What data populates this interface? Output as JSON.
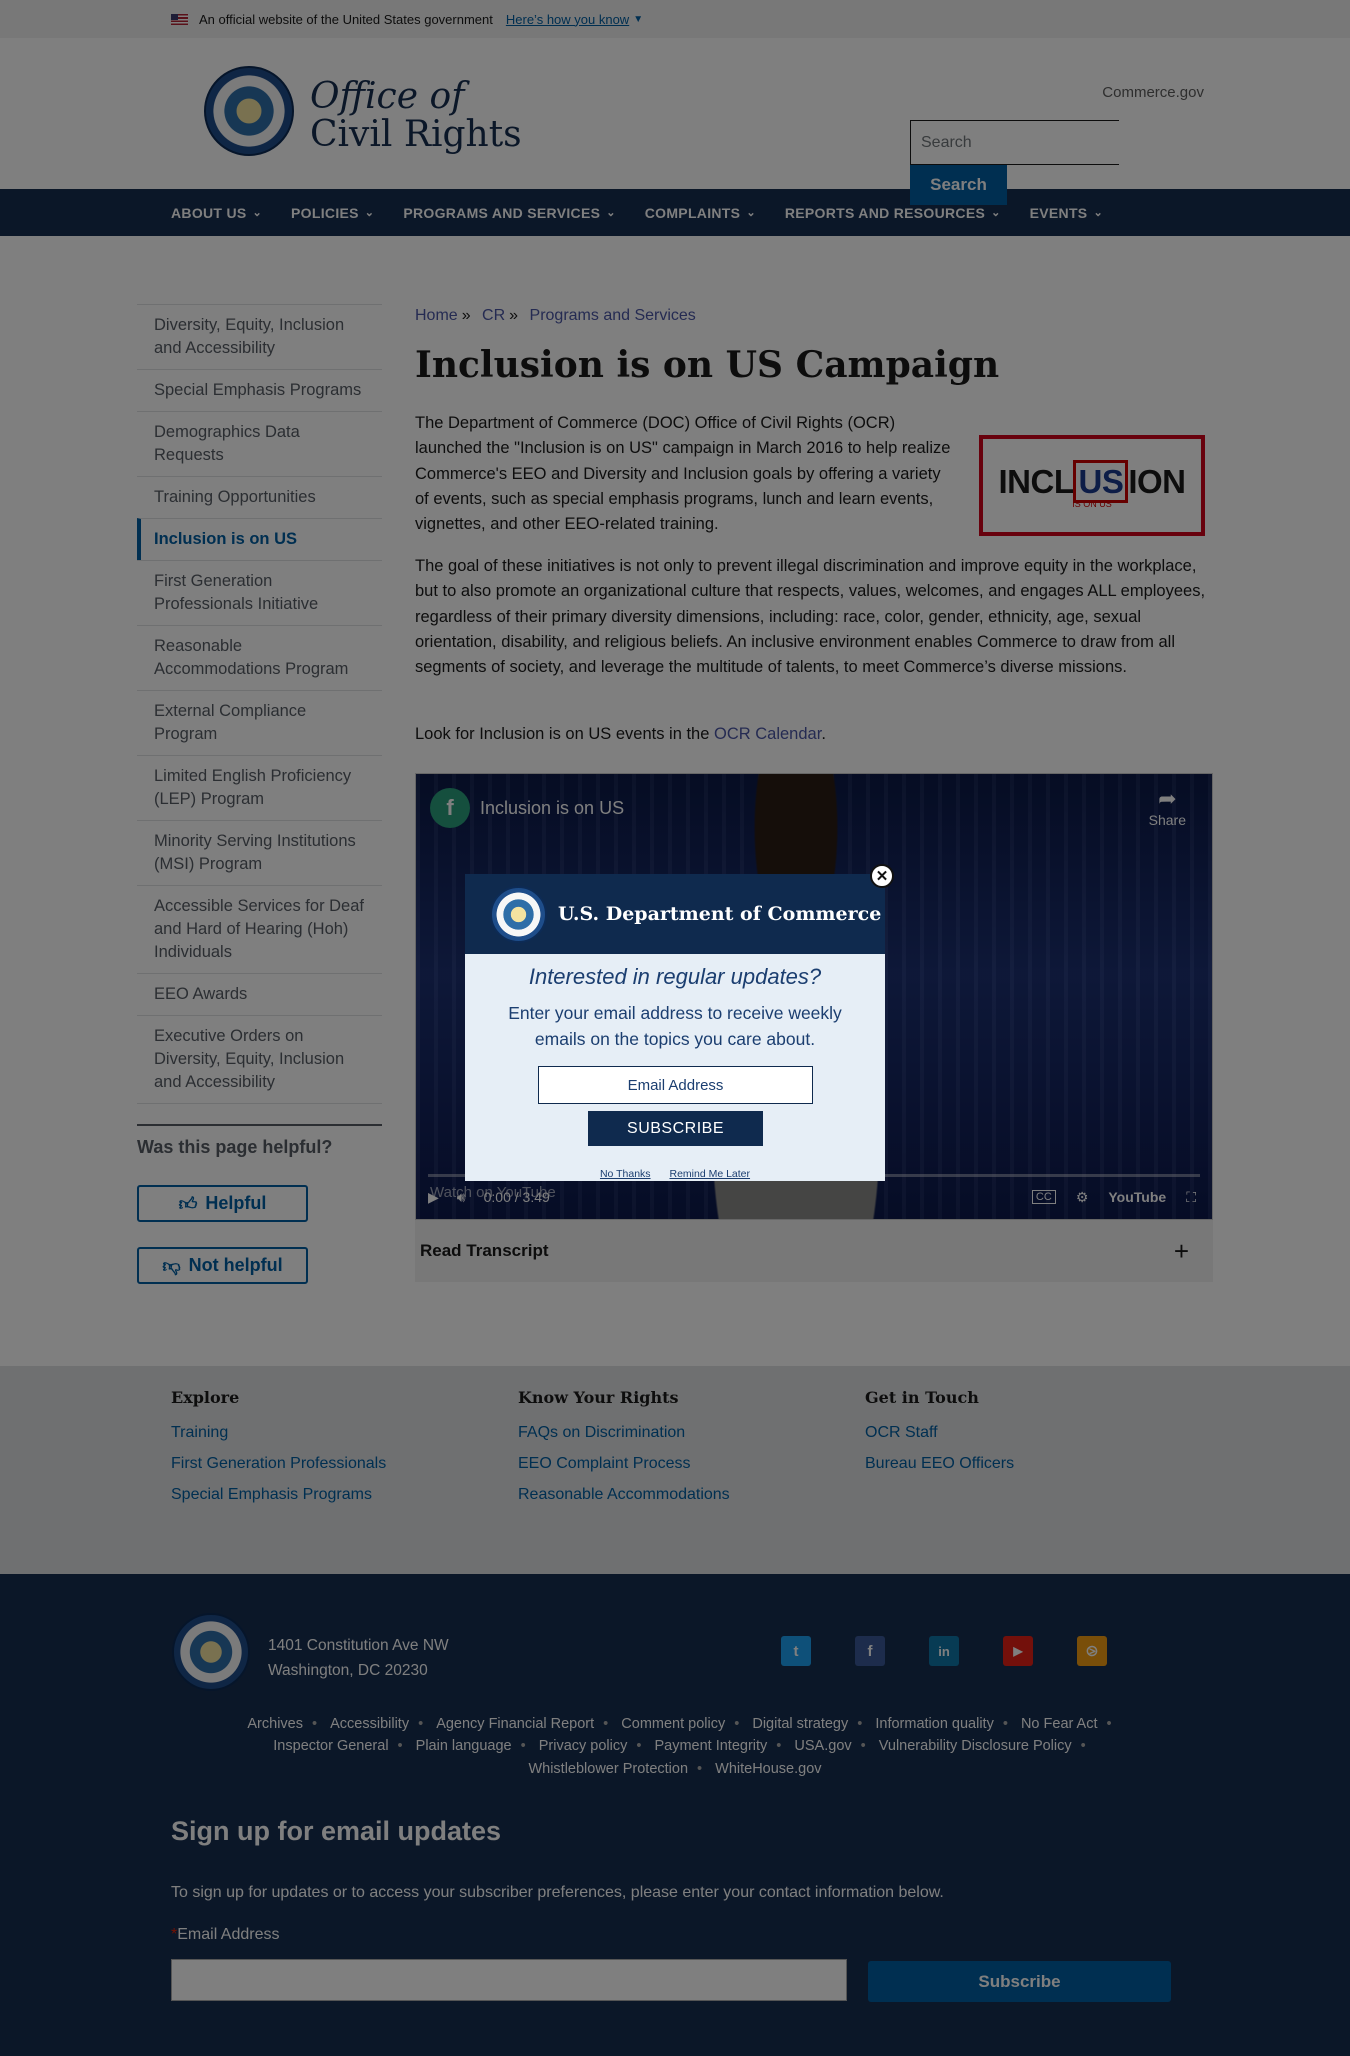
{
  "gov_banner": {
    "text": "An official website of the United States government",
    "link": "Here’s how you know"
  },
  "header": {
    "title_line1": "Office of",
    "title_line2": "Civil Rights",
    "commerce_link": "Commerce.gov",
    "search_placeholder": "Search",
    "search_button": "Search"
  },
  "nav": [
    {
      "label": "ABOUT US"
    },
    {
      "label": "POLICIES"
    },
    {
      "label": "PROGRAMS AND SERVICES"
    },
    {
      "label": "COMPLAINTS"
    },
    {
      "label": "REPORTS AND RESOURCES"
    },
    {
      "label": "EVENTS"
    }
  ],
  "sidenav": [
    {
      "label": "Diversity, Equity, Inclusion and Accessibility"
    },
    {
      "label": "Special Emphasis Programs"
    },
    {
      "label": "Demographics Data Requests"
    },
    {
      "label": "Training Opportunities"
    },
    {
      "label": "Inclusion is on US",
      "active": true
    },
    {
      "label": "First Generation Professionals Initiative"
    },
    {
      "label": "Reasonable Accommodations Program"
    },
    {
      "label": "External Compliance Program"
    },
    {
      "label": "Limited English Proficiency (LEP) Program"
    },
    {
      "label": "Minority Serving Institutions (MSI) Program"
    },
    {
      "label": "Accessible Services for Deaf and Hard of Hearing (Hoh) Individuals"
    },
    {
      "label": "EEO Awards"
    },
    {
      "label": "Executive Orders on Diversity, Equity, Inclusion and Accessibility"
    }
  ],
  "helpful": {
    "title": "Was this page helpful?",
    "yes": "Helpful",
    "no": "Not helpful"
  },
  "breadcrumb": {
    "home": "Home",
    "cr": "CR",
    "programs": "Programs and Services",
    "separator": "»"
  },
  "main": {
    "title": "Inclusion is on US Campaign",
    "p1": "The Department of Commerce (DOC) Office of Civil Rights (OCR) launched the \"Inclusion is on US\" campaign in March 2016 to help realize Commerce's EEO and Diversity and Inclusion goals by offering a variety of events, such as special emphasis programs, lunch and learn events, vignettes, and other EEO-related training.",
    "p2": "The goal of these initiatives is not only to prevent illegal discrimination and improve equity in the workplace, but to also promote an organizational culture that respects, values, welcomes, and engages ALL employees, regardless of their primary diversity dimensions, including: race, color, gender, ethnicity, age, sexual orientation, disability, and religious beliefs. An inclusive environment enables Commerce to draw from all segments of society, and leverage the multitude of talents, to meet Commerce’s diverse missions.",
    "p3_prefix": "Look for Inclusion is on US events in the ",
    "p3_link": "OCR Calendar",
    "p3_suffix": ".",
    "logo_text_a": "INCL",
    "logo_text_b": "US",
    "logo_text_c": "ION",
    "logo_sub": "IS ON US"
  },
  "video": {
    "channel_letter": "f",
    "title": "Inclusion is on US",
    "share": "Share",
    "watch_on": "Watch on",
    "youtube": "YouTube",
    "time": "0:00 / 3:49",
    "cc": "CC"
  },
  "transcript": {
    "label": "Read Transcript"
  },
  "modal": {
    "title": "U.S. Department of Commerce",
    "question": "Interested in regular updates?",
    "description": "Enter your email address to receive weekly emails on the topics you care about.",
    "email_placeholder": "Email Address",
    "subscribe": "SUBSCRIBE",
    "no_thanks": "No Thanks",
    "remind_later": "Remind Me Later"
  },
  "footer_links": {
    "explore": {
      "title": "Explore",
      "links": [
        "Training",
        "First Generation Professionals",
        "Special Emphasis Programs"
      ]
    },
    "rights": {
      "title": "Know Your Rights",
      "links": [
        "FAQs on Discrimination",
        "EEO Complaint Process",
        "Reasonable Accommodations"
      ]
    },
    "contact": {
      "title": "Get in Touch",
      "links": [
        "OCR Staff",
        "Bureau EEO Officers"
      ]
    }
  },
  "footer": {
    "address_line1": "1401 Constitution Ave NW",
    "address_line2": "Washington, DC 20230",
    "social": [
      "twitter-icon",
      "facebook-icon",
      "linkedin-icon",
      "youtube-icon",
      "rss-icon"
    ],
    "legal_row1": [
      "Archives",
      "Accessibility",
      "Agency Financial Report",
      "Comment policy",
      "Digital strategy",
      "Information quality",
      "No Fear Act"
    ],
    "legal_row2": [
      "Inspector General",
      "Plain language",
      "Privacy policy",
      "Payment Integrity",
      "USA.gov",
      "Vulnerability Disclosure Policy"
    ],
    "legal_row3": [
      "Whistleblower Protection",
      "WhiteHouse.gov"
    ],
    "signup_title": "Sign up for email updates",
    "signup_text": "To sign up for updates or to access your subscriber preferences, please enter your contact information below.",
    "signup_required": "*",
    "signup_label": "Email Address",
    "signup_button": "Subscribe"
  },
  "colors": {
    "navy": "#162e51",
    "link": "#005ea2",
    "modal_head": "#0f2a4e"
  }
}
